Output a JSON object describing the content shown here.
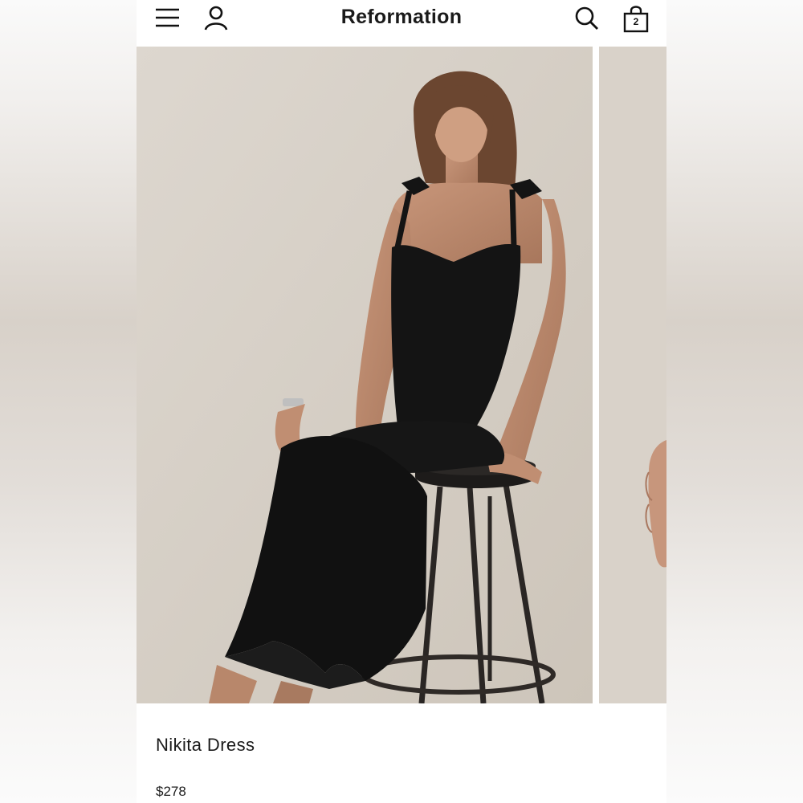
{
  "header": {
    "brand": "Reformation",
    "menu_icon": "menu-icon",
    "account_icon": "account-icon",
    "search_icon": "search-icon",
    "bag_icon": "shopping-bag-icon",
    "bag_count": "2"
  },
  "product": {
    "name": "Nikita Dress",
    "price": "$278",
    "image_main": "black-dress-model-on-stool-photo",
    "image_next": "next-product-photo-peek"
  },
  "colors": {
    "text": "#1a1a1a",
    "photo_background": "#d6cfc6",
    "dress": "#141414"
  }
}
